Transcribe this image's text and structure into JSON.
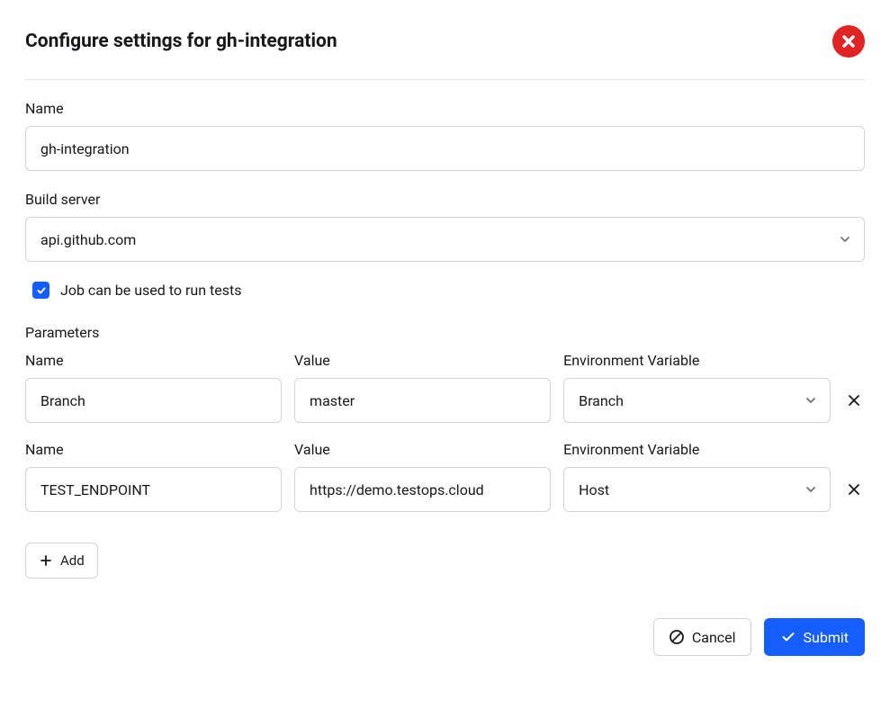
{
  "header": {
    "title": "Configure settings for gh-integration"
  },
  "form": {
    "name_label": "Name",
    "name_value": "gh-integration",
    "build_server_label": "Build server",
    "build_server_value": "api.github.com",
    "checkbox_label": "Job can be used to run tests",
    "checkbox_checked": true
  },
  "parameters": {
    "section_label": "Parameters",
    "columns": {
      "name": "Name",
      "value": "Value",
      "env_var": "Environment Variable"
    },
    "rows": [
      {
        "name": "Branch",
        "value": "master",
        "env_var": "Branch"
      },
      {
        "name": "TEST_ENDPOINT",
        "value": "https://demo.testops.cloud",
        "env_var": "Host"
      }
    ],
    "add_label": "Add"
  },
  "footer": {
    "cancel_label": "Cancel",
    "submit_label": "Submit"
  }
}
